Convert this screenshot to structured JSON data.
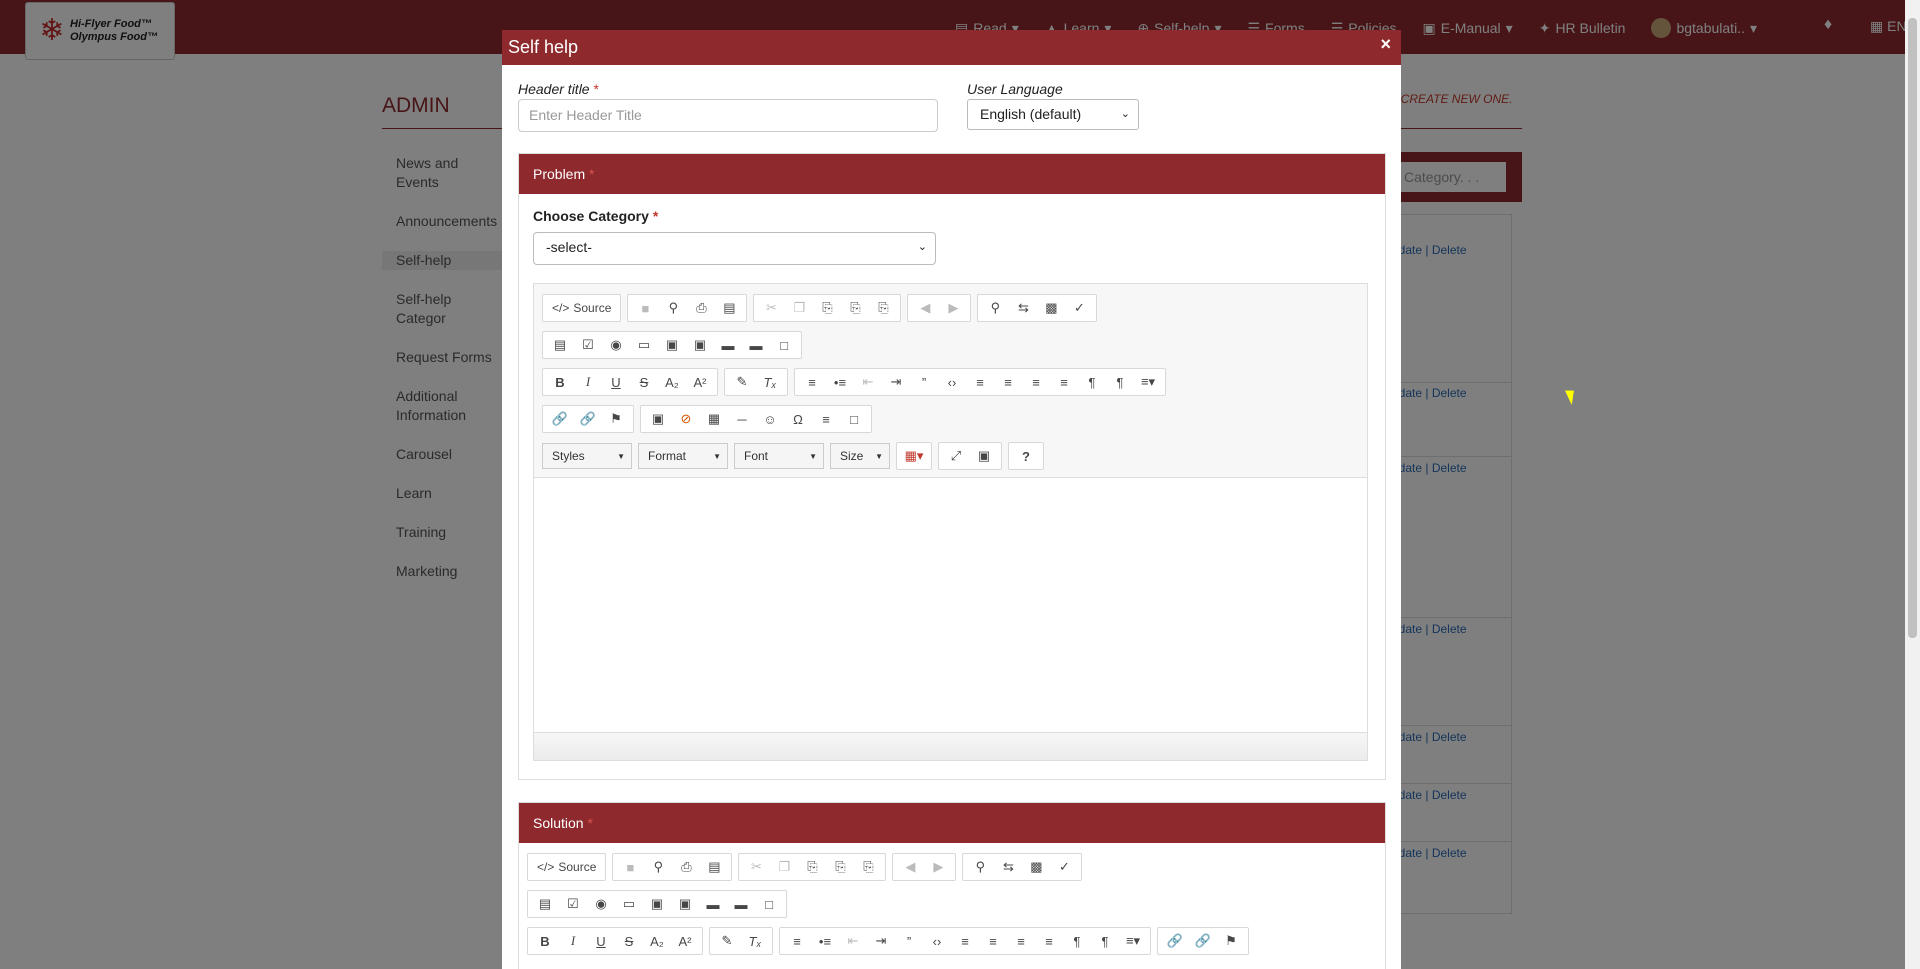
{
  "navbar": {
    "logo_line1": "Hi-Flyer Food™",
    "logo_line2": "Olympus Food™",
    "items": [
      {
        "icon": "book-icon",
        "label": "Read"
      },
      {
        "icon": "graduation-icon",
        "label": "Learn"
      },
      {
        "icon": "plus-circle-icon",
        "label": "Self-help"
      },
      {
        "icon": "list-icon",
        "label": "Forms"
      },
      {
        "icon": "list-icon",
        "label": "Policies"
      },
      {
        "icon": "manual-icon",
        "label": "E-Manual"
      },
      {
        "icon": "pin-icon",
        "label": "HR Bulletin"
      }
    ],
    "user": "bgtabulati..",
    "lang": "EN"
  },
  "page": {
    "title": "ADMIN",
    "create_hint": "O CREATE NEW ONE.",
    "category_placeholder": "Category. . .",
    "side_menu": [
      "News and Events",
      "Announcements",
      "Self-help",
      "Self-help Categor",
      "Request Forms",
      "Additional",
      "Information",
      "Carousel",
      "Learn",
      "Training",
      "Marketing"
    ],
    "row_actions": "odate | Delete"
  },
  "modal": {
    "title": "Self help",
    "close": "×",
    "header_title_label": "Header title",
    "header_title_placeholder": "Enter Header Title",
    "user_language_label": "User Language",
    "user_language_value": "English (default)",
    "problem_heading": "Problem",
    "choose_category_label": "Choose Category",
    "category_value": "-select-",
    "solution_heading": "Solution",
    "required_mark": "*"
  },
  "editor": {
    "source_label": "Source",
    "combos": [
      "Styles",
      "Format",
      "Font",
      "Size"
    ],
    "help": "?"
  }
}
